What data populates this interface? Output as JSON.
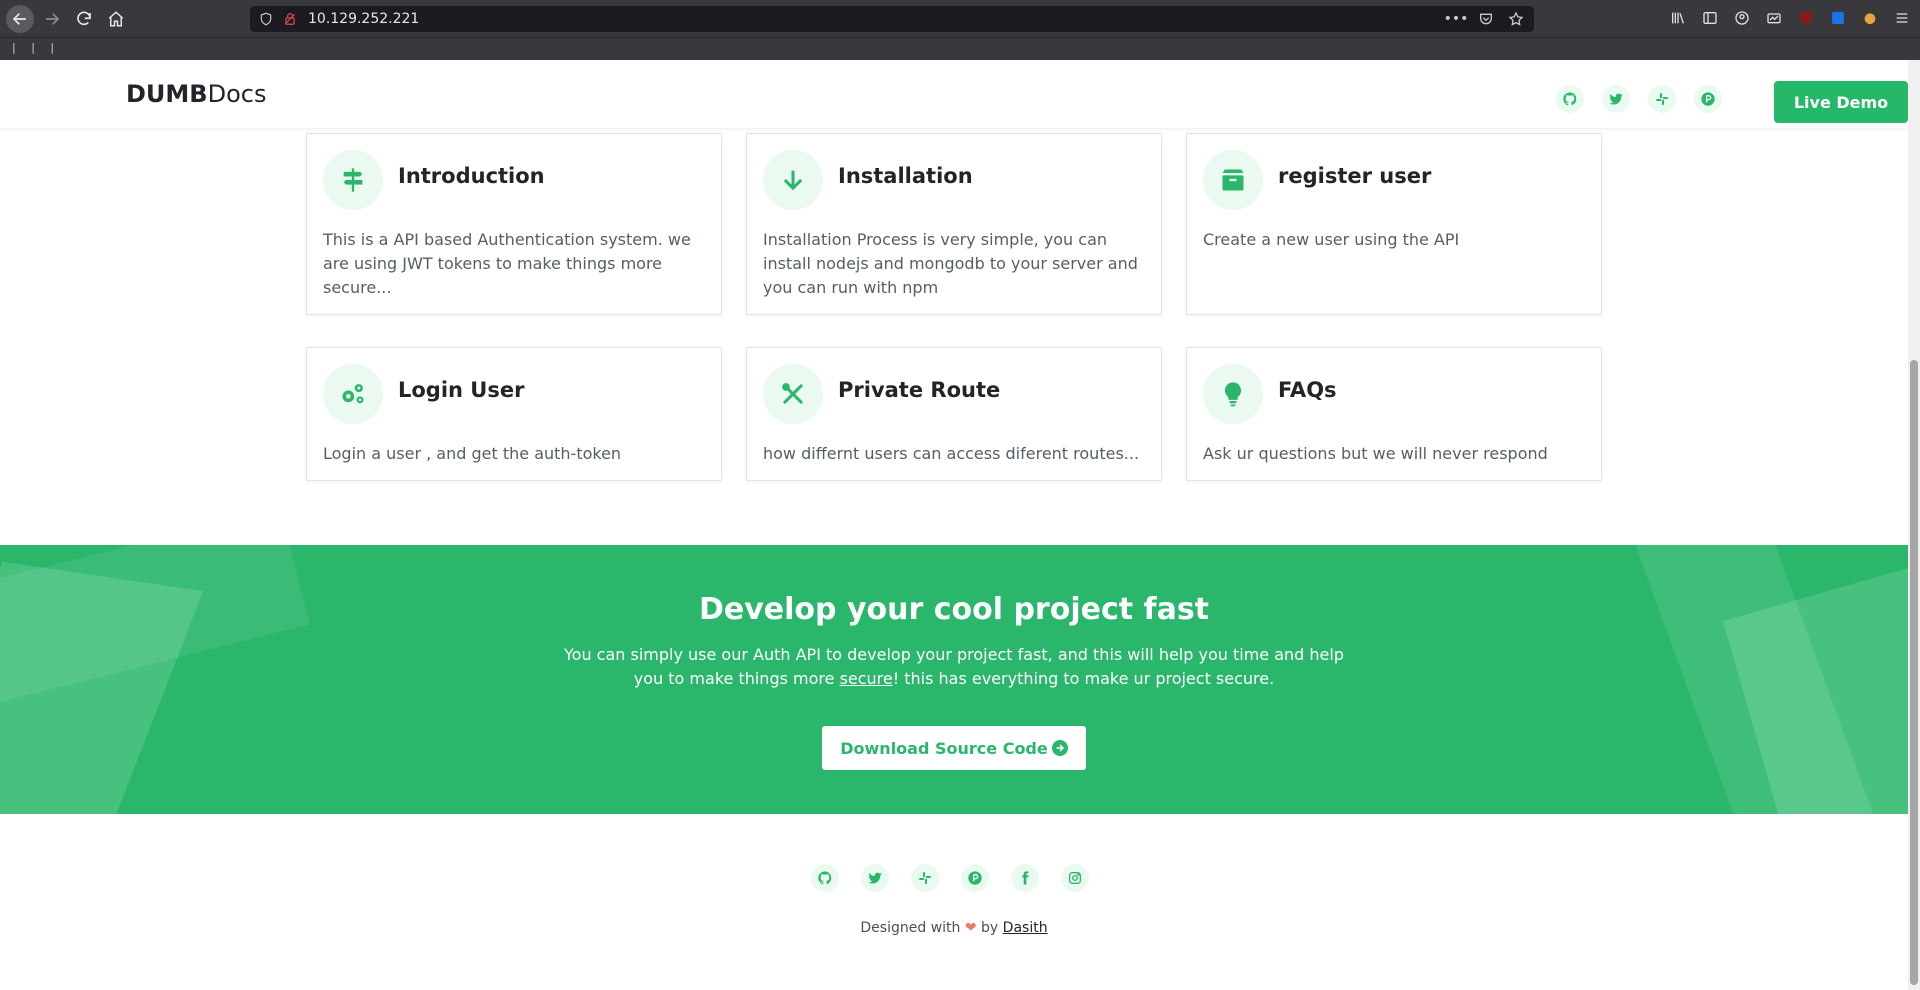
{
  "browser": {
    "url": "10.129.252.221",
    "bookmarks_marker": "| | |"
  },
  "header": {
    "logo_bold": "DUMB",
    "logo_light": "Docs",
    "socials": [
      "github-icon",
      "twitter-icon",
      "slack-icon",
      "product-hunt-icon"
    ],
    "live_demo_label": "Live Demo"
  },
  "cards": [
    {
      "title": "Introduction",
      "text": "This is a API based Authentication system. we are using JWT tokens to make things more secure...",
      "icon": "signpost-icon"
    },
    {
      "title": "Installation",
      "text": "Installation Process is very simple, you can install nodejs and mongodb to your server and you can run with npm",
      "icon": "arrow-down-icon"
    },
    {
      "title": "register user",
      "text": "Create a new user using the API",
      "icon": "box-icon"
    },
    {
      "title": "Login User",
      "text": "Login a user , and get the auth-token",
      "icon": "cogs-icon"
    },
    {
      "title": "Private Route",
      "text": "how differnt users can access diferent routes...",
      "icon": "tools-icon"
    },
    {
      "title": "FAQs",
      "text": "Ask ur questions but we will never respond",
      "icon": "lightbulb-icon"
    }
  ],
  "cta": {
    "title": "Develop your cool project fast",
    "text_before": "You can simply use our Auth API to develop your project fast, and this will help you time and help you to make things more ",
    "text_link": "secure",
    "text_after": "! this has everything to make ur project secure.",
    "button_label": "Download Source Code"
  },
  "footer": {
    "socials": [
      "github-icon",
      "twitter-icon",
      "slack-icon",
      "product-hunt-icon",
      "facebook-icon",
      "instagram-icon"
    ],
    "designed_with": "Designed with",
    "by": "by",
    "author": "Dasith"
  },
  "colors": {
    "brand_green": "#2ab76b",
    "heart": "#f07a62"
  }
}
